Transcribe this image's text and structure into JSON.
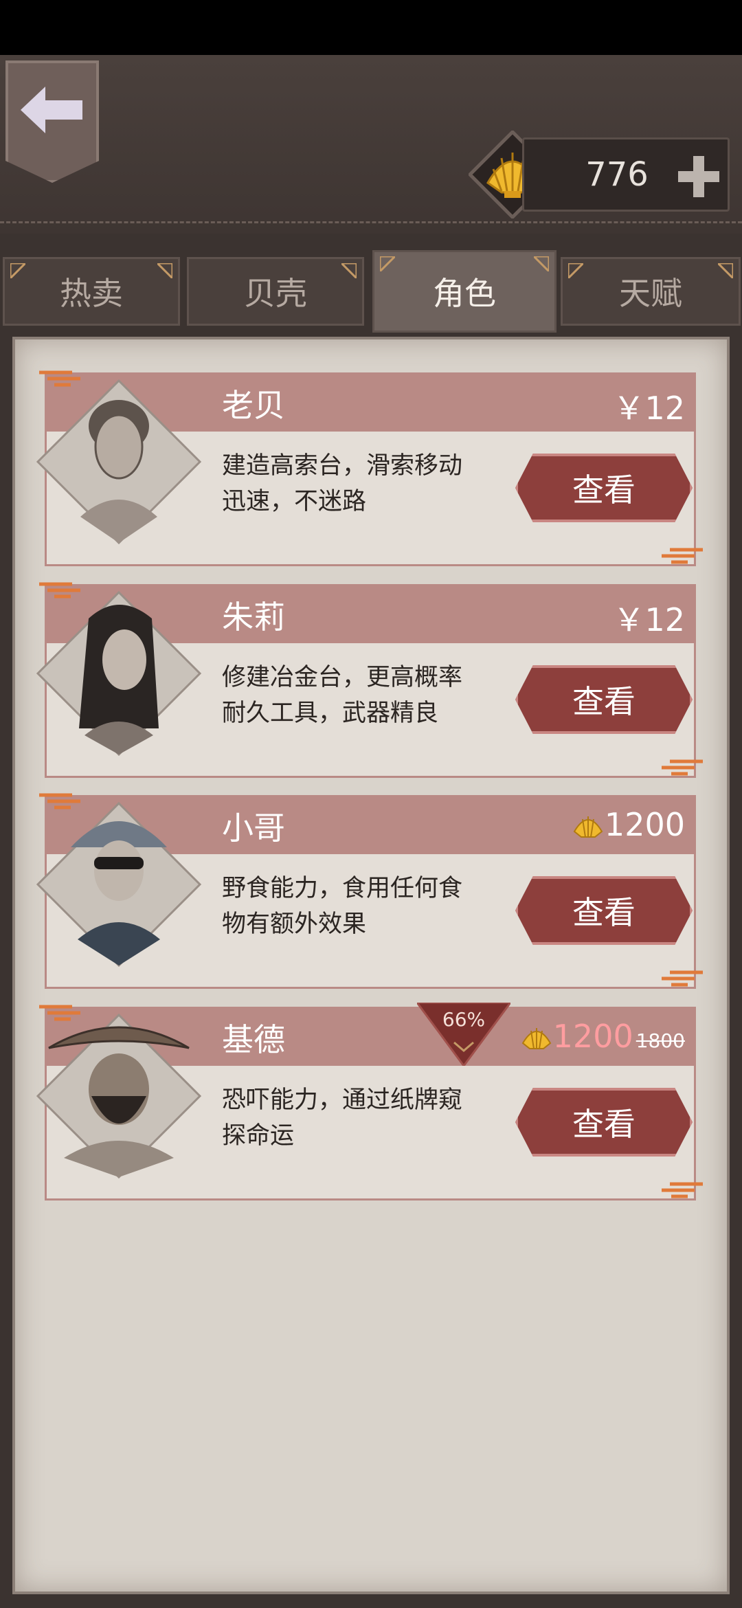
{
  "currency": {
    "shells": "776"
  },
  "tabs": [
    {
      "label": "热卖",
      "active": false
    },
    {
      "label": "贝壳",
      "active": false
    },
    {
      "label": "角色",
      "active": true
    },
    {
      "label": "天赋",
      "active": false
    }
  ],
  "characters": [
    {
      "name": "老贝",
      "price": "￥12",
      "description": "建造高索台，滑索移动迅速，不迷路",
      "button": "查看"
    },
    {
      "name": "朱莉",
      "price": "￥12",
      "description": "修建冶金台，更高概率耐久工具，武器精良",
      "button": "查看"
    },
    {
      "name": "小哥",
      "price": "1200",
      "description": "野食能力，食用任何食物有额外效果",
      "button": "查看"
    },
    {
      "name": "基德",
      "price": "1200",
      "old_price": "1800",
      "discount": "66%",
      "description": "恐吓能力，通过纸牌窥探命运",
      "button": "查看"
    }
  ],
  "colors": {
    "header": "#b98a85",
    "button": "#8d3f3c",
    "paper": "#d9d3cb"
  }
}
